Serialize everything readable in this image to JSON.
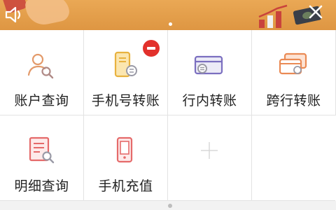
{
  "banner": {
    "dots": 1
  },
  "tiles": [
    {
      "id": "account-query",
      "label": "账户查询",
      "icon": "user-search-icon",
      "color": "#e39a6a"
    },
    {
      "id": "phone-transfer",
      "label": "手机号转账",
      "icon": "phone-transfer-icon",
      "color": "#e8b23f",
      "badge": "remove"
    },
    {
      "id": "intra-bank-transfer",
      "label": "行内转账",
      "icon": "card-transfer-icon",
      "color": "#7b6fc0"
    },
    {
      "id": "inter-bank-transfer",
      "label": "跨行转账",
      "icon": "card-exchange-icon",
      "color": "#ea8a54"
    },
    {
      "id": "detail-query",
      "label": "明细查询",
      "icon": "document-search-icon",
      "color": "#e56a6a"
    },
    {
      "id": "phone-recharge",
      "label": "手机充值",
      "icon": "phone-recharge-icon",
      "color": "#e56a6a"
    },
    {
      "id": "add",
      "label": "",
      "icon": "plus-icon",
      "color": "#d8d8d8"
    }
  ],
  "pager": {
    "current": 1
  }
}
